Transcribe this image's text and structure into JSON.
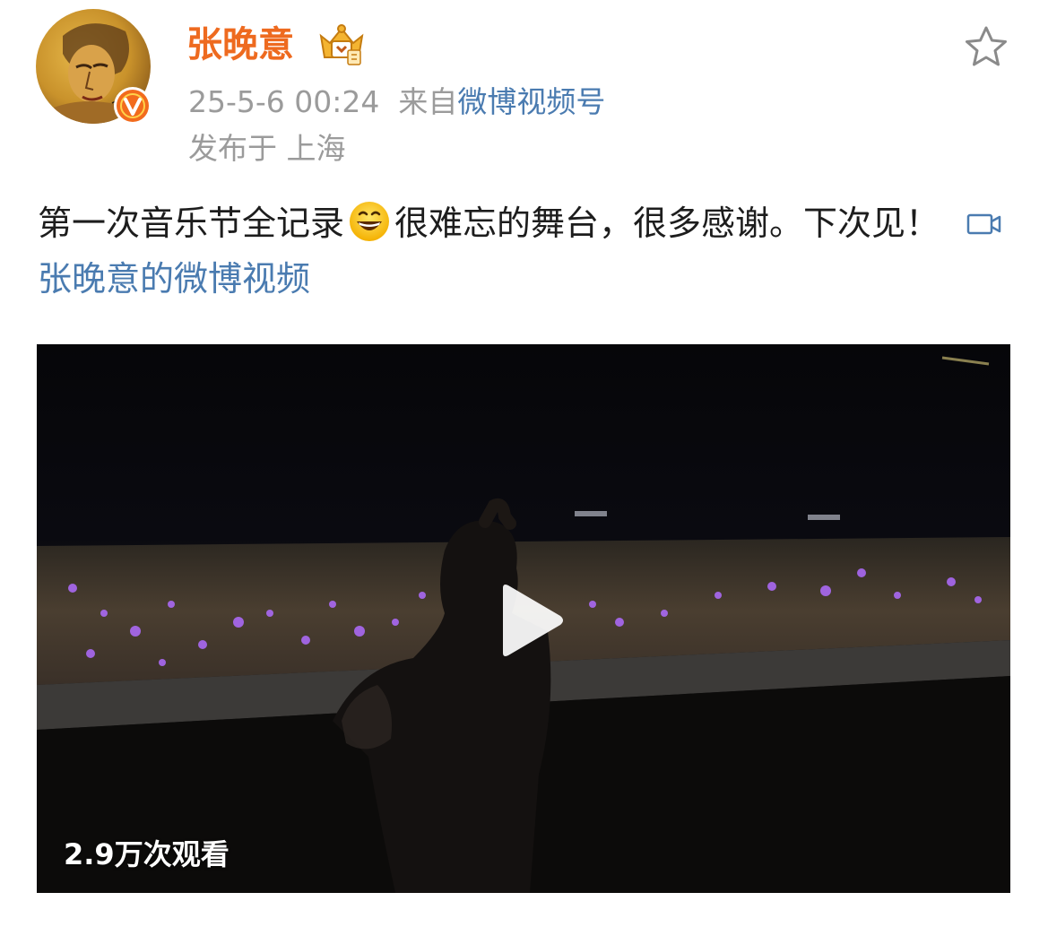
{
  "post": {
    "username": "张晚意",
    "timestamp": "25-5-6 00:24",
    "source_prefix": "来自",
    "source": "微博视频号",
    "location": "发布于 上海",
    "text_part1": "第一次音乐节全记录",
    "text_part2": "很难忘的舞台，很多感谢。下次见！",
    "emoji": "grinning-face",
    "video_link_label": "张晚意的微博视频"
  },
  "video": {
    "views": "2.9万次观看"
  },
  "colors": {
    "username": "#ee6a1f",
    "link": "#4a7bb0",
    "meta": "#9b9b9b",
    "badge": "#f26b1d"
  }
}
